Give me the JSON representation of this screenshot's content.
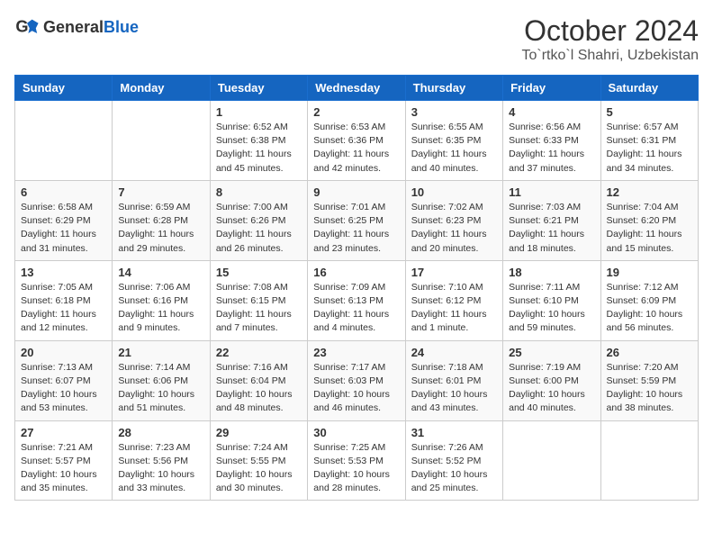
{
  "header": {
    "logo_general": "General",
    "logo_blue": "Blue",
    "month": "October 2024",
    "location": "To`rtko`l Shahri, Uzbekistan"
  },
  "days_of_week": [
    "Sunday",
    "Monday",
    "Tuesday",
    "Wednesday",
    "Thursday",
    "Friday",
    "Saturday"
  ],
  "weeks": [
    [
      {
        "day": null,
        "info": null
      },
      {
        "day": null,
        "info": null
      },
      {
        "day": "1",
        "info": "Sunrise: 6:52 AM\nSunset: 6:38 PM\nDaylight: 11 hours and 45 minutes."
      },
      {
        "day": "2",
        "info": "Sunrise: 6:53 AM\nSunset: 6:36 PM\nDaylight: 11 hours and 42 minutes."
      },
      {
        "day": "3",
        "info": "Sunrise: 6:55 AM\nSunset: 6:35 PM\nDaylight: 11 hours and 40 minutes."
      },
      {
        "day": "4",
        "info": "Sunrise: 6:56 AM\nSunset: 6:33 PM\nDaylight: 11 hours and 37 minutes."
      },
      {
        "day": "5",
        "info": "Sunrise: 6:57 AM\nSunset: 6:31 PM\nDaylight: 11 hours and 34 minutes."
      }
    ],
    [
      {
        "day": "6",
        "info": "Sunrise: 6:58 AM\nSunset: 6:29 PM\nDaylight: 11 hours and 31 minutes."
      },
      {
        "day": "7",
        "info": "Sunrise: 6:59 AM\nSunset: 6:28 PM\nDaylight: 11 hours and 29 minutes."
      },
      {
        "day": "8",
        "info": "Sunrise: 7:00 AM\nSunset: 6:26 PM\nDaylight: 11 hours and 26 minutes."
      },
      {
        "day": "9",
        "info": "Sunrise: 7:01 AM\nSunset: 6:25 PM\nDaylight: 11 hours and 23 minutes."
      },
      {
        "day": "10",
        "info": "Sunrise: 7:02 AM\nSunset: 6:23 PM\nDaylight: 11 hours and 20 minutes."
      },
      {
        "day": "11",
        "info": "Sunrise: 7:03 AM\nSunset: 6:21 PM\nDaylight: 11 hours and 18 minutes."
      },
      {
        "day": "12",
        "info": "Sunrise: 7:04 AM\nSunset: 6:20 PM\nDaylight: 11 hours and 15 minutes."
      }
    ],
    [
      {
        "day": "13",
        "info": "Sunrise: 7:05 AM\nSunset: 6:18 PM\nDaylight: 11 hours and 12 minutes."
      },
      {
        "day": "14",
        "info": "Sunrise: 7:06 AM\nSunset: 6:16 PM\nDaylight: 11 hours and 9 minutes."
      },
      {
        "day": "15",
        "info": "Sunrise: 7:08 AM\nSunset: 6:15 PM\nDaylight: 11 hours and 7 minutes."
      },
      {
        "day": "16",
        "info": "Sunrise: 7:09 AM\nSunset: 6:13 PM\nDaylight: 11 hours and 4 minutes."
      },
      {
        "day": "17",
        "info": "Sunrise: 7:10 AM\nSunset: 6:12 PM\nDaylight: 11 hours and 1 minute."
      },
      {
        "day": "18",
        "info": "Sunrise: 7:11 AM\nSunset: 6:10 PM\nDaylight: 10 hours and 59 minutes."
      },
      {
        "day": "19",
        "info": "Sunrise: 7:12 AM\nSunset: 6:09 PM\nDaylight: 10 hours and 56 minutes."
      }
    ],
    [
      {
        "day": "20",
        "info": "Sunrise: 7:13 AM\nSunset: 6:07 PM\nDaylight: 10 hours and 53 minutes."
      },
      {
        "day": "21",
        "info": "Sunrise: 7:14 AM\nSunset: 6:06 PM\nDaylight: 10 hours and 51 minutes."
      },
      {
        "day": "22",
        "info": "Sunrise: 7:16 AM\nSunset: 6:04 PM\nDaylight: 10 hours and 48 minutes."
      },
      {
        "day": "23",
        "info": "Sunrise: 7:17 AM\nSunset: 6:03 PM\nDaylight: 10 hours and 46 minutes."
      },
      {
        "day": "24",
        "info": "Sunrise: 7:18 AM\nSunset: 6:01 PM\nDaylight: 10 hours and 43 minutes."
      },
      {
        "day": "25",
        "info": "Sunrise: 7:19 AM\nSunset: 6:00 PM\nDaylight: 10 hours and 40 minutes."
      },
      {
        "day": "26",
        "info": "Sunrise: 7:20 AM\nSunset: 5:59 PM\nDaylight: 10 hours and 38 minutes."
      }
    ],
    [
      {
        "day": "27",
        "info": "Sunrise: 7:21 AM\nSunset: 5:57 PM\nDaylight: 10 hours and 35 minutes."
      },
      {
        "day": "28",
        "info": "Sunrise: 7:23 AM\nSunset: 5:56 PM\nDaylight: 10 hours and 33 minutes."
      },
      {
        "day": "29",
        "info": "Sunrise: 7:24 AM\nSunset: 5:55 PM\nDaylight: 10 hours and 30 minutes."
      },
      {
        "day": "30",
        "info": "Sunrise: 7:25 AM\nSunset: 5:53 PM\nDaylight: 10 hours and 28 minutes."
      },
      {
        "day": "31",
        "info": "Sunrise: 7:26 AM\nSunset: 5:52 PM\nDaylight: 10 hours and 25 minutes."
      },
      {
        "day": null,
        "info": null
      },
      {
        "day": null,
        "info": null
      }
    ]
  ]
}
